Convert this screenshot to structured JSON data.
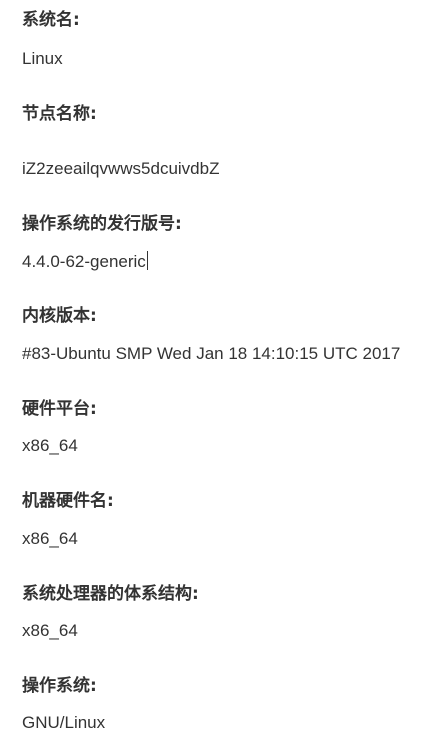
{
  "fields": [
    {
      "label": "系统名:",
      "value": "Linux"
    },
    {
      "label": "节点名称:",
      "value": "iZ2zeeailqvwws5dcuivdbZ"
    },
    {
      "label": "操作系统的发行版号:",
      "value": "4.4.0-62-generic"
    },
    {
      "label": "内核版本:",
      "value": "#83-Ubuntu SMP Wed Jan 18 14:10:15 UTC 2017"
    },
    {
      "label": "硬件平台:",
      "value": "x86_64"
    },
    {
      "label": "机器硬件名:",
      "value": "x86_64"
    },
    {
      "label": "系统处理器的体系结构:",
      "value": "x86_64"
    },
    {
      "label": "操作系统:",
      "value": "GNU/Linux"
    }
  ]
}
